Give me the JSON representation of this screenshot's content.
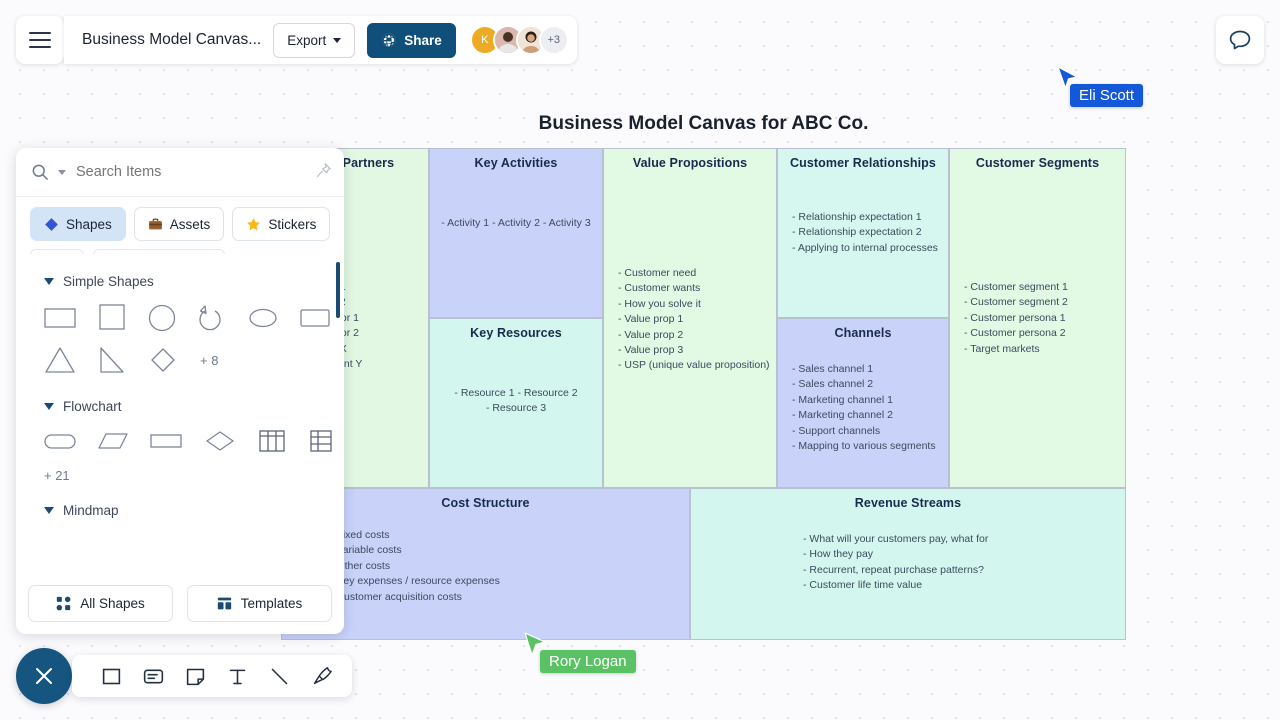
{
  "topbar": {
    "menu_icon": "hamburger-menu-icon",
    "doc_title": "Business Model Canvas...",
    "export_label": "Export",
    "share_label": "Share",
    "share_icon": "globe-icon",
    "avatars": [
      {
        "initial": "K",
        "color": "#edab24"
      },
      {
        "initial": "",
        "color": "#d8a79c"
      },
      {
        "initial": "",
        "color": "#e6d5c4"
      }
    ],
    "avatar_overflow": "+3",
    "comment_icon": "comment-bubble-icon"
  },
  "panel": {
    "search": {
      "placeholder": "Search Items",
      "value": "",
      "icon": "search-icon",
      "dropdown_icon": "chevron-down-icon",
      "pin_icon": "pin-icon"
    },
    "categories": [
      {
        "label": "Shapes",
        "icon": "blue-diamond-icon",
        "active": true
      },
      {
        "label": "Assets",
        "icon": "briefcase-icon",
        "active": false
      },
      {
        "label": "Stickers",
        "icon": "star-icon",
        "active": false
      }
    ],
    "groups": [
      {
        "label": "Simple Shapes",
        "shapes": [
          "rectangle",
          "square",
          "circle",
          "arc-arrow",
          "ellipse",
          "rounded-rectangle",
          "triangle",
          "right-triangle",
          "diamond"
        ],
        "more": "+ 8"
      },
      {
        "label": "Flowchart",
        "shapes": [
          "stadium",
          "parallelogram",
          "process-rectangle",
          "decision-diamond",
          "table-3col",
          "table-grid"
        ],
        "more": "+ 21"
      },
      {
        "label": "Mindmap",
        "shapes": [],
        "more": ""
      }
    ],
    "footer": [
      {
        "label": "All Shapes",
        "icon": "all-shapes-icon"
      },
      {
        "label": "Templates",
        "icon": "templates-icon"
      }
    ]
  },
  "board": {
    "title": "Business Model Canvas for ABC Co.",
    "cells": [
      {
        "id": "key-partners",
        "title": "Key Partners",
        "color": "#e3f8e2",
        "items": [
          "Partner 1",
          "Partner 2",
          "Distributor 1",
          "Distributor 2",
          "Agency X",
          "Consultant Y"
        ]
      },
      {
        "id": "key-activities",
        "title": "Key Activities",
        "color": "#c9d2f9",
        "items": [
          "Activity 1",
          "Activity 2",
          "Activity 3"
        ]
      },
      {
        "id": "key-resources",
        "title": "Key Resources",
        "color": "#d3f7ee",
        "items": [
          "Resource 1",
          "Resource 2",
          "Resource 3"
        ]
      },
      {
        "id": "value-propositions",
        "title": "Value Propositions",
        "color": "#e2f9e4",
        "items": [
          "Customer need",
          "Customer wants",
          "How you solve it",
          "Value prop 1",
          "Value prop 2",
          "Value prop 3",
          "USP (unique value proposition)"
        ]
      },
      {
        "id": "customer-relationships",
        "title": "Customer Relationships",
        "color": "#d6f7ef",
        "items": [
          "Relationship expectation 1",
          "Relationship expectation 2",
          "Applying to internal processes"
        ]
      },
      {
        "id": "channels",
        "title": "Channels",
        "color": "#c9d2f9",
        "items": [
          "Sales channel 1",
          "Sales channel 2",
          "Marketing channel 1",
          "Marketing channel 2",
          "Support channels",
          "Mapping to various segments"
        ]
      },
      {
        "id": "customer-segments",
        "title": "Customer Segments",
        "color": "#e2f9e4",
        "items": [
          "Customer segment 1",
          "Customer segment 2",
          "Customer persona 1",
          "Customer persona 2",
          "Target markets"
        ]
      },
      {
        "id": "cost-structure",
        "title": "Cost Structure",
        "color": "#c9d2f9",
        "items": [
          "Fixed costs",
          "Variable costs",
          "Other costs",
          "Key expenses / resource expenses",
          "Customer acquisition costs"
        ]
      },
      {
        "id": "revenue-streams",
        "title": "Revenue Streams",
        "color": "#d3f7ee",
        "items": [
          "What will your customers pay, what for",
          "How they pay",
          "Recurrent, repeat purchase patterns?",
          "Customer life time value"
        ]
      }
    ]
  },
  "bottom_toolbar": {
    "close_icon": "close-x-icon",
    "tools": [
      {
        "icon": "square-shape-icon",
        "name": "shape-tool"
      },
      {
        "icon": "card-icon",
        "name": "card-tool"
      },
      {
        "icon": "sticky-note-icon",
        "name": "note-tool"
      },
      {
        "icon": "text-icon",
        "name": "text-tool"
      },
      {
        "icon": "line-icon",
        "name": "line-tool"
      },
      {
        "icon": "pen-icon",
        "name": "pen-tool"
      }
    ]
  },
  "collaborators": [
    {
      "name": "Eli Scott",
      "color": "#1358d8"
    },
    {
      "name": "Rory Logan",
      "color": "#5ac264"
    }
  ]
}
